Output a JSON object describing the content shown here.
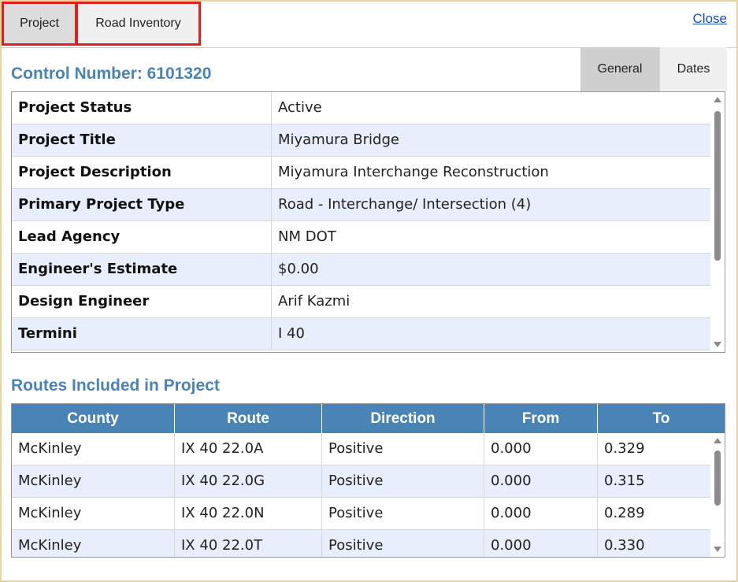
{
  "tabs": {
    "project": "Project",
    "road_inventory": "Road Inventory"
  },
  "close_label": "Close",
  "control_number_title": "Control Number: 6101320",
  "subtabs": {
    "general": "General",
    "dates": "Dates"
  },
  "details": [
    {
      "label": "Project Status",
      "value": "Active"
    },
    {
      "label": "Project Title",
      "value": "Miyamura Bridge"
    },
    {
      "label": "Project Description",
      "value": "Miyamura Interchange Reconstruction"
    },
    {
      "label": "Primary Project Type",
      "value": "Road - Interchange/ Intersection (4)"
    },
    {
      "label": "Lead Agency",
      "value": "NM DOT"
    },
    {
      "label": "Engineer's Estimate",
      "value": "$0.00"
    },
    {
      "label": "Design Engineer",
      "value": "Arif Kazmi"
    },
    {
      "label": "Termini",
      "value": "I 40"
    }
  ],
  "routes_title": "Routes Included in Project",
  "routes_columns": [
    "County",
    "Route",
    "Direction",
    "From",
    "To"
  ],
  "routes": [
    [
      "McKinley",
      "IX 40 22.0A",
      "Positive",
      "0.000",
      "0.329"
    ],
    [
      "McKinley",
      "IX 40 22.0G",
      "Positive",
      "0.000",
      "0.315"
    ],
    [
      "McKinley",
      "IX 40 22.0N",
      "Positive",
      "0.000",
      "0.289"
    ],
    [
      "McKinley",
      "IX 40 22.0T",
      "Positive",
      "0.000",
      "0.330"
    ]
  ],
  "colors": {
    "accent": "#4a83b5",
    "highlight_border": "#e02020",
    "row_alt": "#e8eefb",
    "frame": "#e5d3a2"
  }
}
